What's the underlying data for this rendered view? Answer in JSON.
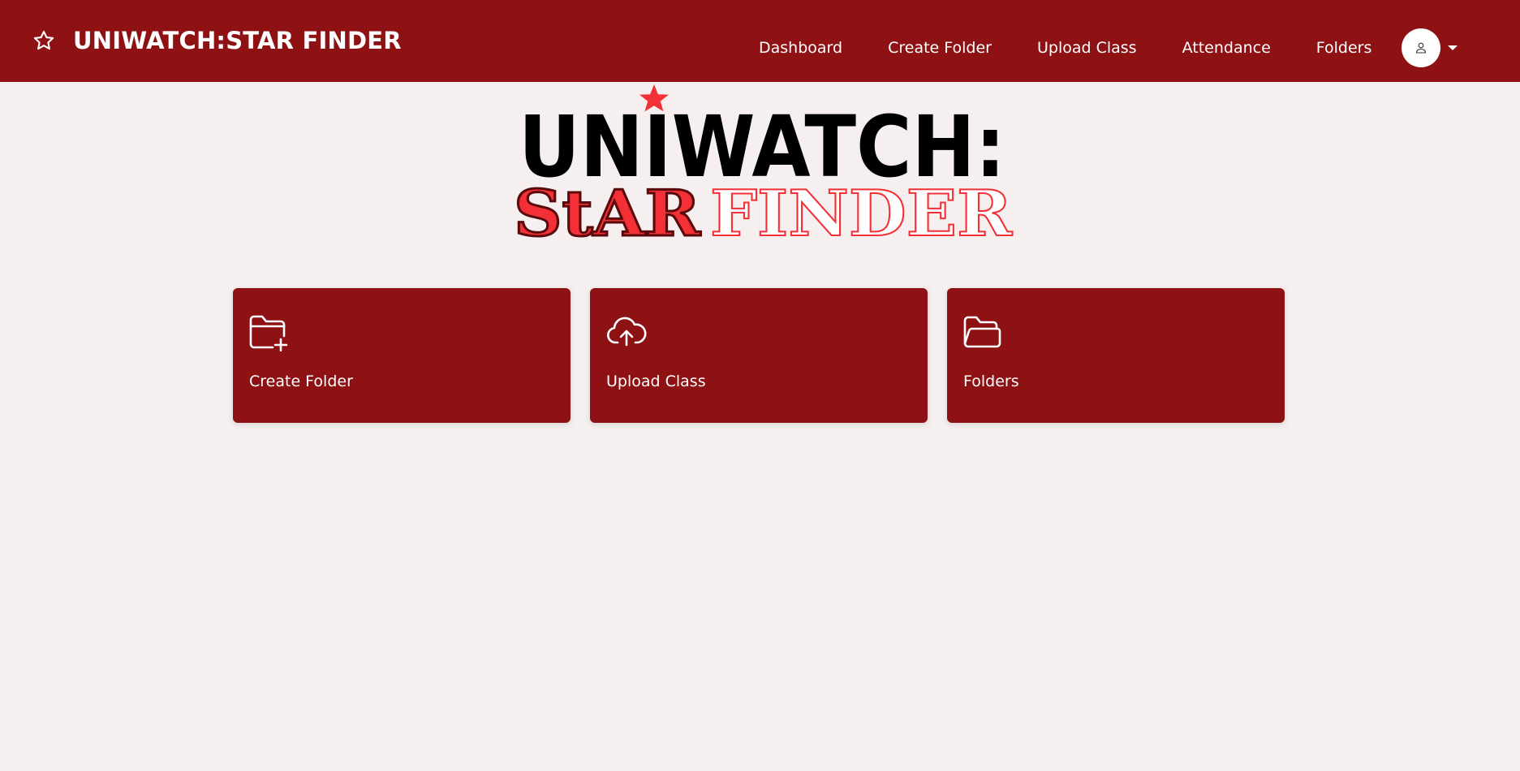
{
  "app": {
    "title": "UNIWATCH:STAR FINDER"
  },
  "nav": {
    "links": [
      "Dashboard",
      "Create Folder",
      "Upload Class",
      "Attendance",
      "Folders"
    ]
  },
  "logo": {
    "line1": "UNIWATCH:",
    "line2_part1": "StAR",
    "line2_part2": "FINDER"
  },
  "cards": [
    {
      "label": "Create Folder",
      "icon": "folder-plus-icon"
    },
    {
      "label": "Upload Class",
      "icon": "cloud-upload-icon"
    },
    {
      "label": "Folders",
      "icon": "folder-open-icon"
    }
  ],
  "colors": {
    "brand": "#8e1114",
    "accent": "#f33035",
    "background": "#f5f0ef"
  }
}
